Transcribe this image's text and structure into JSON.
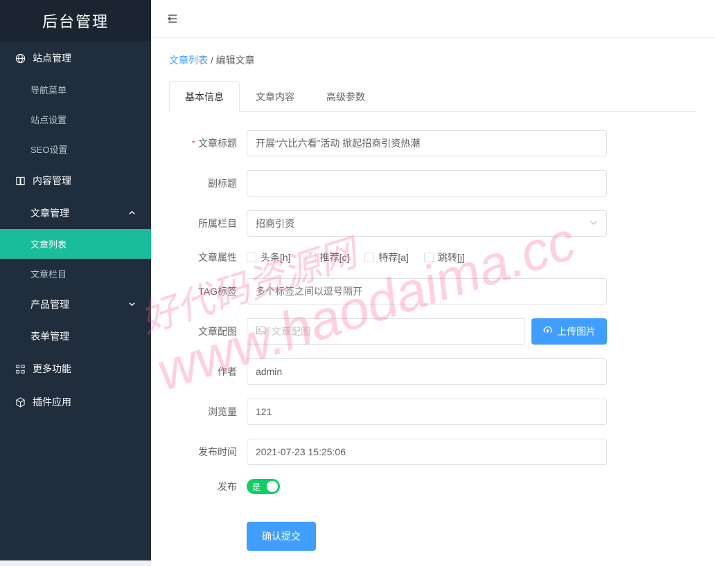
{
  "logo": "后台管理",
  "sidebar": {
    "site": {
      "label": "站点管理",
      "items": [
        "导航菜单",
        "站点设置",
        "SEO设置"
      ]
    },
    "content": {
      "label": "内容管理",
      "article": {
        "label": "文章管理",
        "items": [
          "文章列表",
          "文章栏目"
        ]
      },
      "product": {
        "label": "产品管理"
      },
      "form": {
        "label": "表单管理"
      }
    },
    "more": {
      "label": "更多功能"
    },
    "plugin": {
      "label": "插件应用"
    }
  },
  "breadcrumb": {
    "link": "文章列表",
    "sep": " / ",
    "current": "编辑文章"
  },
  "tabs": [
    "基本信息",
    "文章内容",
    "高级参数"
  ],
  "form": {
    "title": {
      "label": "文章标题",
      "value": "开展“六比六看”活动 掀起招商引资热潮"
    },
    "subtitle": {
      "label": "副标题",
      "value": ""
    },
    "category": {
      "label": "所属栏目",
      "value": "招商引资"
    },
    "attrs": {
      "label": "文章属性",
      "options": [
        "头条[h]",
        "推荐[c]",
        "特荐[a]",
        "跳转[j]"
      ]
    },
    "tags": {
      "label": "TAG标签",
      "placeholder": "多个标签之间以逗号隔开"
    },
    "image": {
      "label": "文章配图",
      "placeholder": "文章配图",
      "button": "上传图片"
    },
    "author": {
      "label": "作者",
      "value": "admin"
    },
    "views": {
      "label": "浏览量",
      "value": "121"
    },
    "pubtime": {
      "label": "发布时间",
      "value": "2021-07-23 15:25:06"
    },
    "publish": {
      "label": "发布",
      "state": "是"
    }
  },
  "submit": "确认提交",
  "watermark": {
    "line1": "好代码资源网",
    "line2": "www.haodaima.cc"
  }
}
